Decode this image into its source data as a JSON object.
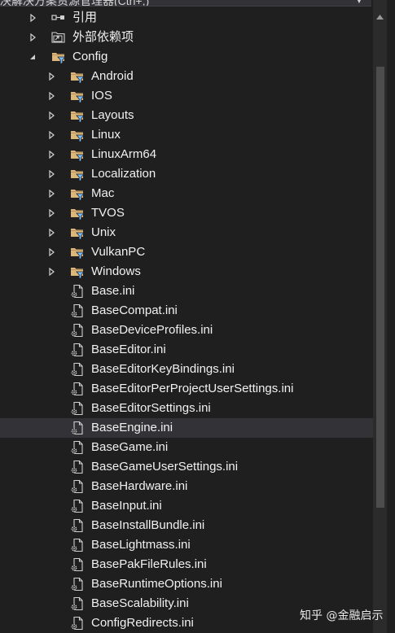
{
  "header": {
    "text": "决解决方案资源管理器(Ctrl+;)",
    "dropdown_icon": "chevron-down-icon"
  },
  "tree": {
    "references": {
      "label": "引用",
      "icon": "references-icon"
    },
    "external_deps": {
      "label": "外部依赖项",
      "icon": "external-dependencies-icon"
    },
    "config": {
      "label": "Config",
      "icon": "filtered-folder-icon",
      "expanded": true
    },
    "folders": [
      "Android",
      "IOS",
      "Layouts",
      "Linux",
      "LinuxArm64",
      "Localization",
      "Mac",
      "TVOS",
      "Unix",
      "VulkanPC",
      "Windows"
    ],
    "files": [
      "Base.ini",
      "BaseCompat.ini",
      "BaseDeviceProfiles.ini",
      "BaseEditor.ini",
      "BaseEditorKeyBindings.ini",
      "BaseEditorPerProjectUserSettings.ini",
      "BaseEditorSettings.ini",
      "BaseEngine.ini",
      "BaseGame.ini",
      "BaseGameUserSettings.ini",
      "BaseHardware.ini",
      "BaseInput.ini",
      "BaseInstallBundle.ini",
      "BaseLightmass.ini",
      "BasePakFileRules.ini",
      "BaseRuntimeOptions.ini",
      "BaseScalability.ini",
      "ConfigRedirects.ini"
    ],
    "selected_file": "BaseEngine.ini"
  },
  "watermark": {
    "text": "知乎 @金融启示"
  },
  "colors": {
    "background": "#1f1f1f",
    "selection": "#333337",
    "folder": "#dcb67a",
    "filter": "#75beff",
    "text": "#f1f1f1"
  }
}
